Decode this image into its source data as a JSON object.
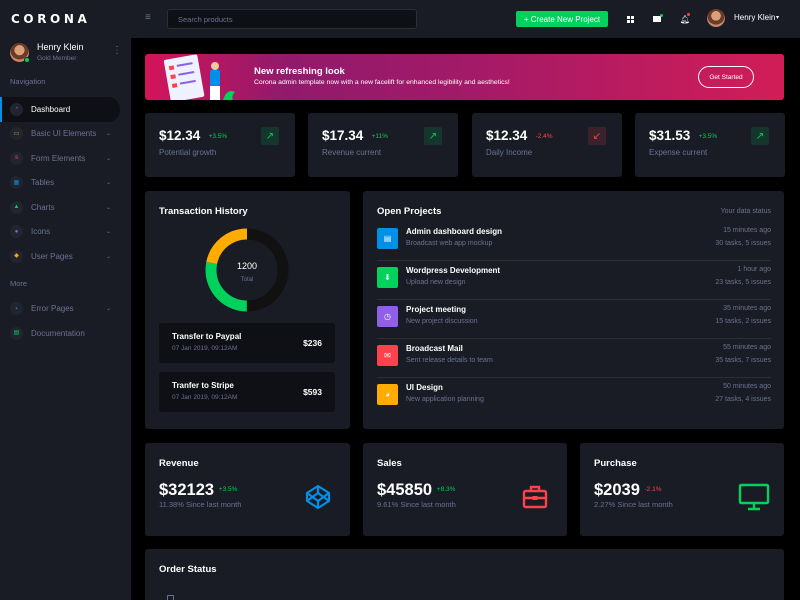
{
  "brand": "CORONA",
  "profile": {
    "name": "Henry Klein",
    "role": "Gold Member"
  },
  "sidebar": {
    "nav_title": "Navigation",
    "items": [
      {
        "label": "Dashboard",
        "icon": "speedometer-icon",
        "color": "#8f5fe8",
        "chevron": false
      },
      {
        "label": "Basic UI Elements",
        "icon": "laptop-icon",
        "color": "#ffab00",
        "chevron": true
      },
      {
        "label": "Form Elements",
        "icon": "playlist-icon",
        "color": "#fc424a",
        "chevron": true
      },
      {
        "label": "Tables",
        "icon": "table-icon",
        "color": "#0090e7",
        "chevron": true
      },
      {
        "label": "Charts",
        "icon": "chart-icon",
        "color": "#00d25b",
        "chevron": true
      },
      {
        "label": "Icons",
        "icon": "contacts-icon",
        "color": "#8f5fe8",
        "chevron": true
      },
      {
        "label": "User Pages",
        "icon": "security-icon",
        "color": "#ffab00",
        "chevron": true
      }
    ],
    "more_title": "More",
    "more_items": [
      {
        "label": "Error Pages",
        "icon": "lock-icon",
        "color": "#0090e7",
        "chevron": true
      },
      {
        "label": "Documentation",
        "icon": "file-icon",
        "color": "#00d25b",
        "chevron": false
      }
    ]
  },
  "navbar": {
    "search_placeholder": "Search products",
    "create_label": "+ Create New Project",
    "user_name": "Henry Klein"
  },
  "banner": {
    "title": "New refreshing look",
    "subtitle": "Corona admin template now with a new facelift for enhanced legibility and aesthetics!",
    "button": "Get Started"
  },
  "stats": [
    {
      "value": "$12.34",
      "change": "+3.5%",
      "label": "Potential growth",
      "trend": "up"
    },
    {
      "value": "$17.34",
      "change": "+11%",
      "label": "Revenue current",
      "trend": "up"
    },
    {
      "value": "$12.34",
      "change": "-2.4%",
      "label": "Daily Income",
      "trend": "down"
    },
    {
      "value": "$31.53",
      "change": "+3.5%",
      "label": "Expense current",
      "trend": "up"
    }
  ],
  "transactions": {
    "title": "Transaction History",
    "total_value": "1200",
    "total_label": "Total",
    "donut": [
      {
        "color": "#111111",
        "share": 0.5
      },
      {
        "color": "#00d25b",
        "share": 0.28
      },
      {
        "color": "#ffab00",
        "share": 0.22
      }
    ],
    "items": [
      {
        "title": "Transfer to Paypal",
        "date": "07 Jan 2019, 09:12AM",
        "amount": "$236"
      },
      {
        "title": "Tranfer to Stripe",
        "date": "07 Jan 2019, 09:12AM",
        "amount": "$593"
      }
    ]
  },
  "projects": {
    "title": "Open Projects",
    "subtitle": "Your data status",
    "items": [
      {
        "title": "Admin dashboard design",
        "sub": "Broadcast web app mockup",
        "time": "15 minutes ago",
        "tasks": "30 tasks, 5 issues",
        "color": "#0090e7",
        "icon": "file-icon"
      },
      {
        "title": "Wordpress Development",
        "sub": "Upload new design",
        "time": "1 hour ago",
        "tasks": "23 tasks, 5 issues",
        "color": "#00d25b",
        "icon": "cloud-download-icon"
      },
      {
        "title": "Project meeting",
        "sub": "New project discussion",
        "time": "35 minutes ago",
        "tasks": "15 tasks, 2 issues",
        "color": "#8f5fe8",
        "icon": "clock-icon"
      },
      {
        "title": "Broadcast Mail",
        "sub": "Sent release details to team",
        "time": "55 minutes ago",
        "tasks": "35 tasks, 7 issues",
        "color": "#fc424a",
        "icon": "mail-icon"
      },
      {
        "title": "UI Design",
        "sub": "New application planning",
        "time": "50 minutes ago",
        "tasks": "27 tasks, 4 issues",
        "color": "#ffab00",
        "icon": "chart-pie-icon"
      }
    ]
  },
  "summaries": [
    {
      "title": "Revenue",
      "value": "$32123",
      "change": "+3.5%",
      "sub": "11.38% Since last month",
      "trend": "up",
      "icon": "codepen-icon",
      "color": "#0090e7"
    },
    {
      "title": "Sales",
      "value": "$45850",
      "change": "+8.3%",
      "sub": "9.61% Since last month",
      "trend": "up",
      "icon": "briefcase-icon",
      "color": "#fc424a"
    },
    {
      "title": "Purchase",
      "value": "$2039",
      "change": "-2.1%",
      "sub": "2.27% Since last month",
      "trend": "down",
      "icon": "monitor-icon",
      "color": "#00d25b"
    }
  ],
  "order_status": {
    "title": "Order Status"
  }
}
